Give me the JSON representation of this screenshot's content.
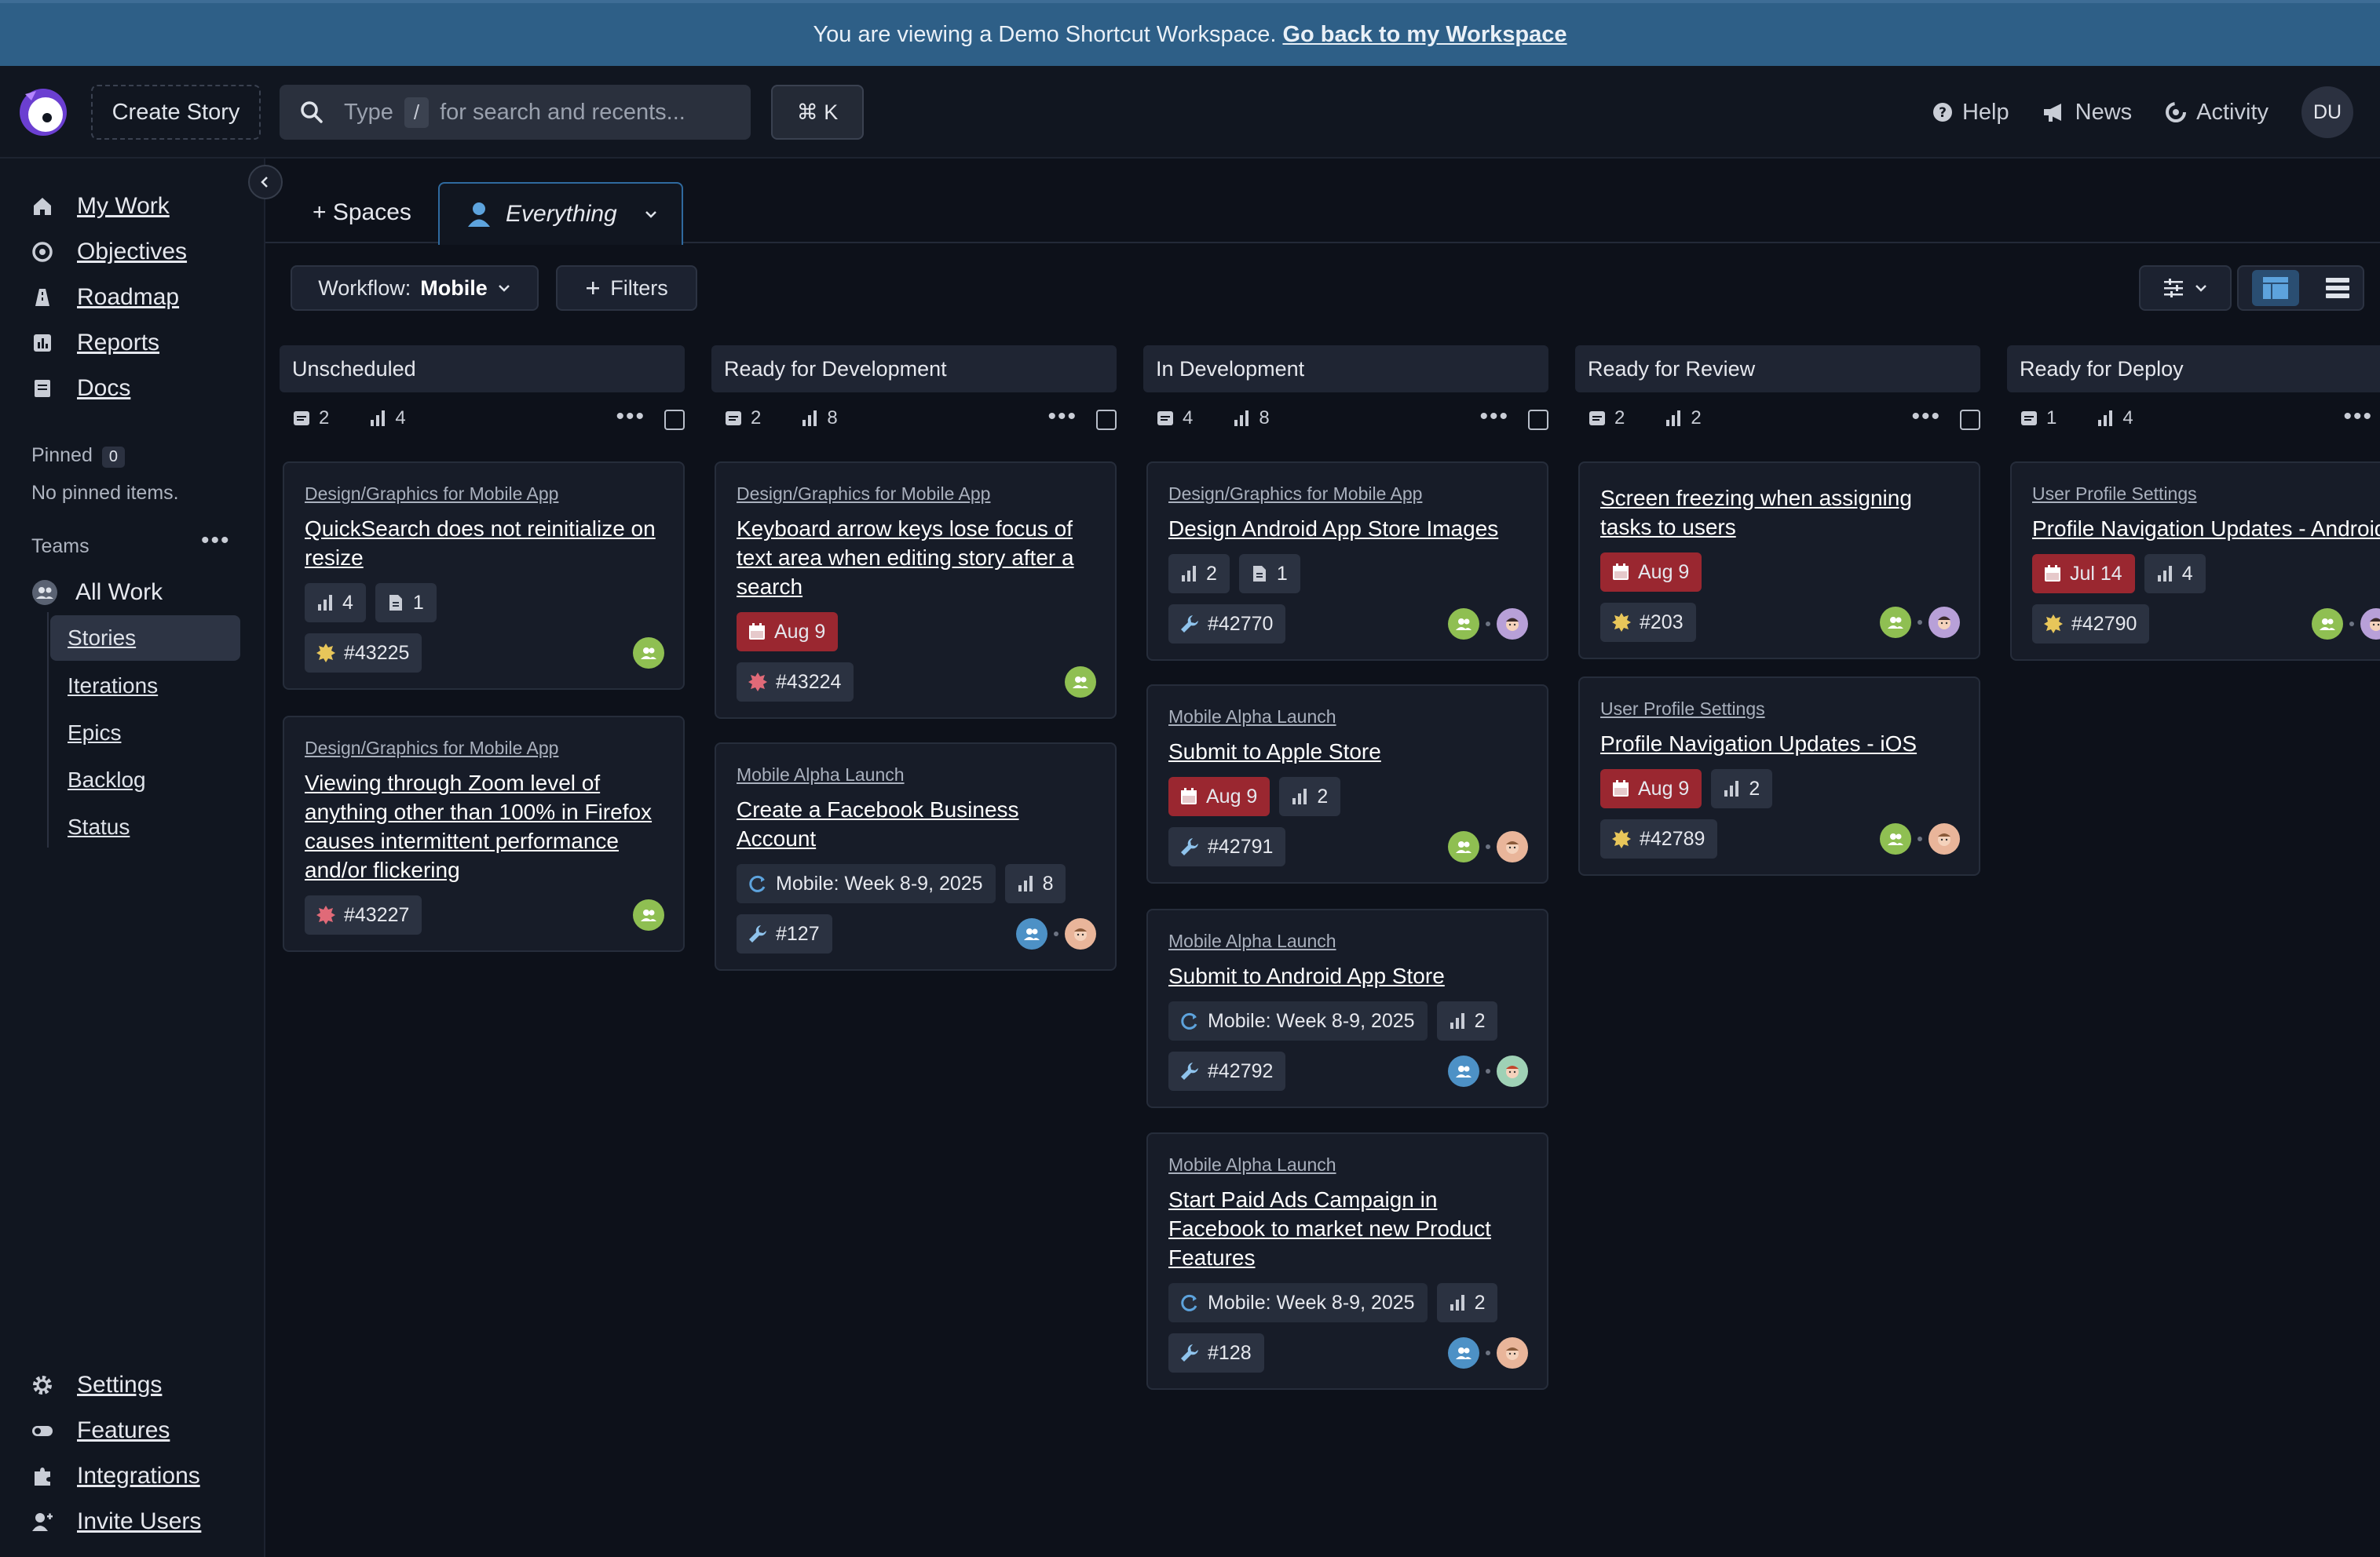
{
  "banner": {
    "text": "You are viewing a Demo Shortcut Workspace.",
    "link": "Go back to my Workspace"
  },
  "topbar": {
    "create_story": "Create Story",
    "search_prefix": "Type",
    "search_key": "/",
    "search_suffix": "for search and recents...",
    "cmd_k": "⌘ K",
    "help": "Help",
    "news": "News",
    "activity": "Activity",
    "avatar_initials": "DU"
  },
  "sidebar": {
    "nav": [
      "My Work",
      "Objectives",
      "Roadmap",
      "Reports",
      "Docs"
    ],
    "pinned_label": "Pinned",
    "pinned_count": "0",
    "no_pinned": "No pinned items.",
    "teams_label": "Teams",
    "all_work": "All Work",
    "sub": [
      "Stories",
      "Iterations",
      "Epics",
      "Backlog",
      "Status"
    ],
    "bottom": [
      "Settings",
      "Features",
      "Integrations",
      "Invite Users"
    ]
  },
  "tabs": {
    "spaces": "+ Spaces",
    "everything": "Everything"
  },
  "filters": {
    "workflow_prefix": "Workflow:",
    "workflow_value": "Mobile",
    "filters": "Filters"
  },
  "columns": [
    {
      "name": "Unscheduled",
      "stories": "2",
      "points": "4",
      "cards": [
        {
          "epic": "Design/Graphics for Mobile App",
          "title": "QuickSearch does not reinitialize on resize",
          "chips": [
            [
              "points",
              "4"
            ],
            [
              "docs",
              "1"
            ]
          ],
          "id": "#43225",
          "type": "feature",
          "avatars": [
            "green"
          ]
        },
        {
          "epic": "Design/Graphics for Mobile App",
          "title": "Viewing through Zoom level of anything other than 100% in Firefox causes intermittent performance and/or flickering",
          "chips": [],
          "id": "#43227",
          "type": "bug",
          "avatars": [
            "green"
          ]
        }
      ]
    },
    {
      "name": "Ready for Development",
      "stories": "2",
      "points": "8",
      "cards": [
        {
          "epic": "Design/Graphics for Mobile App",
          "title": "Keyboard arrow keys lose focus of text area when editing story after a search",
          "chips": [
            [
              "date",
              "Aug 9"
            ]
          ],
          "id": "#43224",
          "type": "bug",
          "avatars": [
            "green"
          ]
        },
        {
          "epic": "Mobile Alpha Launch",
          "title": "Create a Facebook Business Account",
          "chips": [
            [
              "iter",
              "Mobile: Week 8-9, 2025"
            ],
            [
              "points",
              "8"
            ]
          ],
          "id": "#127",
          "type": "chore",
          "avatars": [
            "blue",
            "face"
          ]
        }
      ]
    },
    {
      "name": "In Development",
      "stories": "4",
      "points": "8",
      "cards": [
        {
          "epic": "Design/Graphics for Mobile App",
          "title": "Design Android App Store Images",
          "chips": [
            [
              "points",
              "2"
            ],
            [
              "docs",
              "1"
            ]
          ],
          "id": "#42770",
          "type": "chore",
          "avatars": [
            "green",
            "face2"
          ]
        },
        {
          "epic": "Mobile Alpha Launch",
          "title": "Submit to Apple Store",
          "chips": [
            [
              "date",
              "Aug 9"
            ],
            [
              "points",
              "2"
            ]
          ],
          "id": "#42791",
          "type": "chore",
          "avatars": [
            "green",
            "face"
          ]
        },
        {
          "epic": "Mobile Alpha Launch",
          "title": "Submit to Android App Store",
          "chips": [
            [
              "iter",
              "Mobile: Week 8-9, 2025"
            ],
            [
              "points",
              "2"
            ]
          ],
          "id": "#42792",
          "type": "chore",
          "avatars": [
            "blue",
            "face3"
          ]
        },
        {
          "epic": "Mobile Alpha Launch",
          "title": "Start Paid Ads Campaign in Facebook to market new Product Features",
          "chips": [
            [
              "iter",
              "Mobile: Week 8-9, 2025"
            ],
            [
              "points",
              "2"
            ]
          ],
          "id": "#128",
          "type": "chore",
          "avatars": [
            "blue",
            "face"
          ]
        }
      ]
    },
    {
      "name": "Ready for Review",
      "stories": "2",
      "points": "2",
      "cards": [
        {
          "epic": "",
          "title": "Screen freezing when assigning tasks to users",
          "chips": [
            [
              "date",
              "Aug 9"
            ]
          ],
          "id": "#203",
          "type": "feature",
          "avatars": [
            "green",
            "face2"
          ]
        },
        {
          "epic": "User Profile Settings",
          "title": "Profile Navigation Updates - iOS",
          "chips": [
            [
              "date",
              "Aug 9"
            ],
            [
              "points",
              "2"
            ]
          ],
          "id": "#42789",
          "type": "feature",
          "avatars": [
            "green",
            "face"
          ]
        }
      ]
    },
    {
      "name": "Ready for Deploy",
      "stories": "1",
      "points": "4",
      "cards": [
        {
          "epic": "User Profile Settings",
          "title": "Profile Navigation Updates - Android",
          "chips": [
            [
              "date",
              "Jul 14"
            ],
            [
              "points",
              "4"
            ]
          ],
          "id": "#42790",
          "type": "feature",
          "avatars": [
            "green",
            "face2"
          ]
        }
      ]
    }
  ],
  "colors": {
    "banner": "#2e5f87",
    "date_red": "#9a2730",
    "accent": "#2f6a9f"
  }
}
